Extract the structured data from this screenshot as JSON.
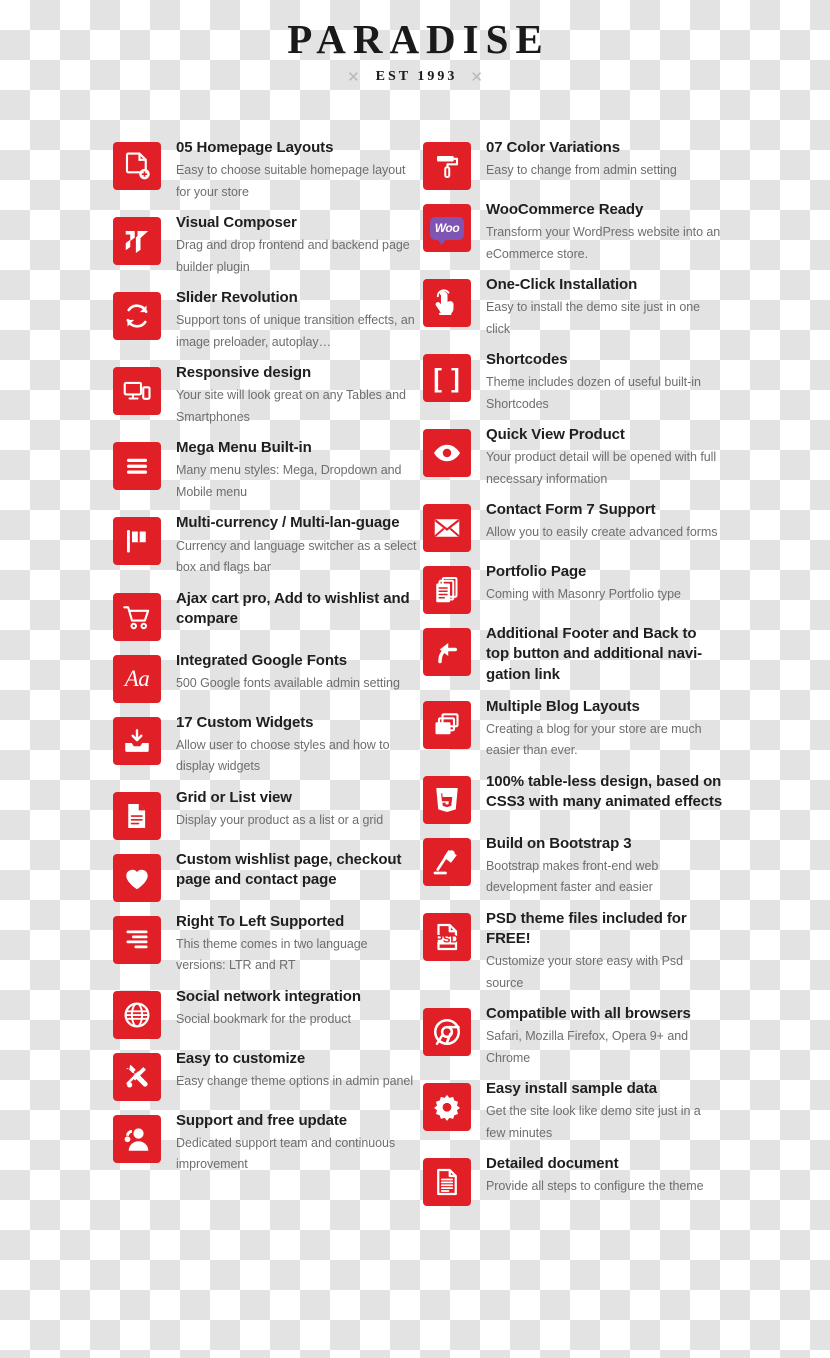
{
  "brand": {
    "name": "PARADISE",
    "established": "EST 1993",
    "ornament_left": "✕",
    "ornament_right": "✕"
  },
  "theme": {
    "accent_red": "#e01f26",
    "title_color": "#1f1f1f",
    "desc_color": "#6e6e6e",
    "woo_purple": "#7f54b3",
    "checker_gray": "#e3e3e3"
  },
  "features_left": [
    {
      "icon": "page-add-icon",
      "title": "05 Homepage Layouts",
      "desc": "Easy to choose suitable homepage layout for your store"
    },
    {
      "icon": "visual-composer-icon",
      "title": "Visual Composer",
      "desc": "Drag and drop frontend and backend page builder plugin"
    },
    {
      "icon": "refresh-cycle-icon",
      "title": "Slider Revolution",
      "desc": "Support tons of unique transition effects, an image preloader, autoplay…"
    },
    {
      "icon": "responsive-devices-icon",
      "title": "Responsive design",
      "desc": "Your site will look great on any Tables and Smartphones"
    },
    {
      "icon": "hamburger-menu-icon",
      "title": "Mega Menu Built-in",
      "desc": "Many menu styles: Mega, Dropdown and Mobile menu"
    },
    {
      "icon": "flag-icon",
      "title": "Multi-currency / Multi-lan-guage",
      "desc": "Currency and language switcher as a select box and flags bar"
    },
    {
      "icon": "shopping-cart-icon",
      "title": "Ajax cart pro, Add to wishlist and compare",
      "desc": ""
    },
    {
      "icon": "font-aa-icon",
      "title": "Integrated Google Fonts",
      "desc": "500 Google fonts available admin setting"
    },
    {
      "icon": "widget-download-icon",
      "title": "17 Custom Widgets",
      "desc": "Allow user to choose styles and how to display widgets"
    },
    {
      "icon": "document-lines-icon",
      "title": "Grid or List view",
      "desc": "Display your product as a list or a grid"
    },
    {
      "icon": "heart-icon",
      "title": "Custom wishlist page, checkout page and contact page",
      "desc": ""
    },
    {
      "icon": "rtl-align-icon",
      "title": "Right To Left Supported",
      "desc": "This theme comes in two language versions: LTR and RT"
    },
    {
      "icon": "globe-icon",
      "title": "Social network integration",
      "desc": "Social bookmark for the product"
    },
    {
      "icon": "tools-wrench-screwdriver-icon",
      "title": "Easy to customize",
      "desc": "Easy change theme options in admin panel"
    },
    {
      "icon": "support-headset-icon",
      "title": "Support and  free update",
      "desc": "Dedicated support team and continuous improvement"
    }
  ],
  "features_right": [
    {
      "icon": "paint-roller-icon",
      "title": "07 Color Variations",
      "desc": "Easy to change from  admin setting"
    },
    {
      "icon": "woocommerce-icon",
      "title": "WooCommerce Ready",
      "desc": "Transform your WordPress website into an eCommerce store."
    },
    {
      "icon": "click-hand-icon",
      "title": "One-Click Installation",
      "desc": "Easy to install the demo site just in one click"
    },
    {
      "icon": "brackets-icon",
      "title": "Shortcodes",
      "desc": "Theme includes dozen of useful built-in Shortcodes"
    },
    {
      "icon": "eye-icon",
      "title": "Quick View Product",
      "desc": "Your product detail will be opened with full necessary information"
    },
    {
      "icon": "envelope-icon",
      "title": "Contact Form 7 Support",
      "desc": "Allow you to easily create advanced forms"
    },
    {
      "icon": "portfolio-stack-icon",
      "title": "Portfolio Page",
      "desc": "Coming with Masonry Portfolio type"
    },
    {
      "icon": "back-to-top-arrow-icon",
      "title": "Additional Footer and Back to top button and additional navi-gation link",
      "desc": ""
    },
    {
      "icon": "layers-blog-icon",
      "title": "Multiple Blog Layouts",
      "desc": "Creating a blog for your store are much easier than ever."
    },
    {
      "icon": "css3-icon",
      "title": "100% table-less design, based on CSS3 with many animated effects",
      "desc": ""
    },
    {
      "icon": "bootstrap-lamp-icon",
      "title": "Build on Bootstrap 3",
      "desc": "Bootstrap makes front-end web development faster and easier"
    },
    {
      "icon": "psd-file-icon",
      "title": "PSD theme files included for FREE!",
      "desc": "Customize your store easy with Psd source"
    },
    {
      "icon": "chrome-browser-icon",
      "title": "Compatible with all browsers",
      "desc": "Safari, Mozilla Firefox, Opera 9+ and Chrome"
    },
    {
      "icon": "gear-icon",
      "title": "Easy install sample data",
      "desc": "Get the site look like demo site just in a few minutes"
    },
    {
      "icon": "detailed-document-icon",
      "title": "Detailed document",
      "desc": "Provide all steps to configure the theme"
    }
  ]
}
